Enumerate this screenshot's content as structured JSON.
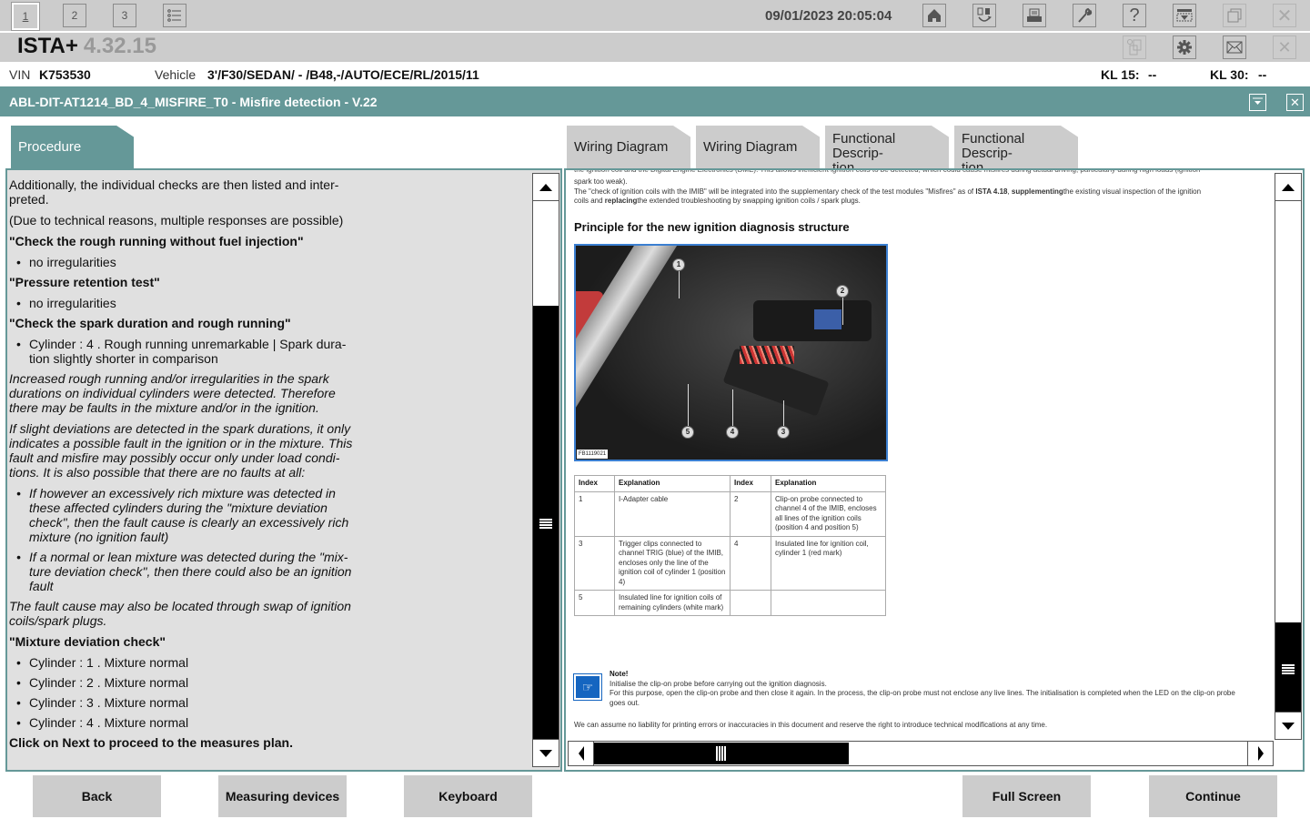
{
  "toolbar": {
    "view_buttons": [
      "1",
      "2",
      "3"
    ],
    "list_icon": "list-icon",
    "datetime": "09/01/2023 20:05:04",
    "icons": [
      "home-icon",
      "swap-icon",
      "print-icon",
      "wrench-icon",
      "help-icon",
      "download-icon",
      "windows-icon",
      "close-icon"
    ]
  },
  "titlebar": {
    "app_name": "ISTA+",
    "version": "4.32.15",
    "icons": [
      "clipboard-icon",
      "gear-icon",
      "mail-icon",
      "close-icon"
    ]
  },
  "vehicle": {
    "vin_label": "VIN",
    "vin": "K753530",
    "vehicle_label": "Vehicle",
    "vehicle": "3'/F30/SEDAN/ - /B48,-/AUTO/ECE/RL/2015/11",
    "kl15_label": "KL 15:",
    "kl15": "--",
    "kl30_label": "KL 30:",
    "kl30": "--"
  },
  "module": {
    "title": "ABL-DIT-AT1214_BD_4_MISFIRE_T0 - Misfire detection - V.22"
  },
  "tabs": {
    "left": [
      {
        "label": "Procedure",
        "active": true
      }
    ],
    "right": [
      {
        "label": "Wiring Diagram"
      },
      {
        "label": "Wiring Diagram"
      },
      {
        "label": "Functional Descrip-\ntion",
        "line1": "Functional Descrip-",
        "line2": "tion"
      },
      {
        "label": "Functional Descrip-\ntion",
        "line1": "Functional Descrip-",
        "line2": "tion"
      }
    ]
  },
  "procedure": {
    "intro": "Additionally, the individual checks are then listed and inter-preted.",
    "note": "(Due to technical reasons, multiple responses are possible)",
    "check1_title": "\"Check the rough running without fuel injection\"",
    "check1_items": [
      "no irregularities"
    ],
    "check2_title": "\"Pressure retention test\"",
    "check2_items": [
      "no irregularities"
    ],
    "check3_title": "\"Check the spark duration and rough running\"",
    "check3_items": [
      "Cylinder : 4 .  Rough running unremarkable | Spark dura-tion slightly shorter in comparison"
    ],
    "italic1": "Increased rough running and/or irregularities in the spark durations on individual cylinders were detected. Therefore there may be faults in the mixture and/or in the ignition.",
    "italic2": "If slight deviations are detected in the spark durations, it only indicates a possible fault in the ignition or in the mixture. This fault and misfire may possibly occur only under load condi-tions. It is also possible that there are no faults at all:",
    "italic_items": [
      "If however an excessively rich mixture was detected in these affected cylinders during the \"mixture deviation check\", then the fault cause is clearly an excessively rich mixture (no ignition fault)",
      "If a normal or lean mixture was detected during the \"mix-ture deviation check\", then there could also be an ignition fault"
    ],
    "italic3": "The fault cause may also be located through swap of ignition coils/spark plugs.",
    "check4_title": "\"Mixture deviation check\"",
    "check4_items": [
      "Cylinder : 1 .  Mixture normal",
      "Cylinder : 2 .  Mixture normal",
      "Cylinder : 3 .  Mixture normal",
      "Cylinder : 4 .  Mixture normal"
    ],
    "footer": "Click on Next to proceed to the measures plan."
  },
  "document": {
    "cut_line": "the ignition coil and the Digital Engine Electronics (DME). This allows inefficient ignition coils to be detected, which could cause misfires during actual driving, particularly during high loads (ignition",
    "line1": "spark too weak).",
    "line2_a": "The \"check of ignition coils with the IMIB\" will be integrated into the supplementary check of the test modules \"Misfires\" as of ",
    "line2_b": "ISTA 4.18",
    "line2_c": ", ",
    "line2_d": "supplementing",
    "line2_e": "the existing visual inspection of the ignition",
    "line3_a": "coils and ",
    "line3_b": "replacing",
    "line3_c": "the extended troubleshooting by swapping ignition coils / spark plugs.",
    "heading": "Principle for the new ignition diagnosis structure",
    "photo_label": "FB1119021",
    "callouts": [
      "1",
      "2",
      "3",
      "4",
      "5"
    ],
    "table": {
      "headers": [
        "Index",
        "Explanation",
        "Index",
        "Explanation"
      ],
      "rows": [
        [
          "1",
          "I-Adapter cable",
          "2",
          "Clip-on probe connected to channel 4 of the IMIB, encloses all lines of the ignition coils (position 4 and position 5)"
        ],
        [
          "3",
          "Trigger clips connected to channel TRIG (blue) of the IMIB,  encloses only the line of the ignition coil of cylinder 1 (position 4)",
          "4",
          "Insulated line for ignition coil, cylinder 1 (red mark)"
        ],
        [
          "5",
          "Insulated line for ignition coils of remaining cylinders (white mark)",
          "",
          ""
        ]
      ]
    },
    "note_title": "Note!",
    "note_line1": "Initialise the clip-on probe before carrying out the ignition diagnosis.",
    "note_line2": "For this purpose, open the clip-on probe and then close it again. In the process, the clip-on probe must not enclose any live lines. The initialisation is completed when the LED on the clip-on probe goes out.",
    "disclaimer": "We can assume no liability for printing errors or inaccuracies in this document and reserve the right to introduce technical modifications at any time."
  },
  "scroll": {
    "left_vertical_position": 0.55,
    "right_vertical_position": 0.95,
    "right_horizontal_position": 0.0
  },
  "buttons": {
    "back": "Back",
    "measuring_devices": "Measuring devices",
    "keyboard": "Keyboard",
    "full_screen": "Full Screen",
    "continue": "Continue"
  },
  "colors": {
    "teal": "#659898",
    "toolbar_gray": "#cccccc",
    "panel_gray": "#e0e0e0",
    "note_blue": "#1565c0"
  }
}
